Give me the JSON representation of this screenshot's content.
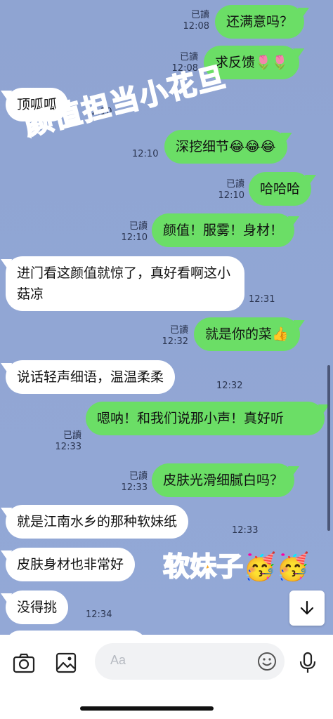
{
  "messages": {
    "m1": {
      "text": "还满意吗？",
      "read": "已讀",
      "time": "12:08"
    },
    "m2": {
      "text": "求反馈🌷🌷",
      "read": "已讀",
      "time": "12:08"
    },
    "m3": {
      "text": "顶呱呱",
      "time": "12:10"
    },
    "m4": {
      "text": "深挖细节😂😂😂",
      "time": "12:10"
    },
    "m5": {
      "text": "哈哈哈",
      "read": "已讀",
      "time": "12:10"
    },
    "m6": {
      "text": "颜值！服雾！身材！",
      "read": "已讀",
      "time": "12:10"
    },
    "m7": {
      "text": "进门看这颜值就惊了，真好看啊这小菇凉",
      "time": "12:31"
    },
    "m8": {
      "text": "就是你的菜👍",
      "read": "已讀",
      "time": "12:32"
    },
    "m9": {
      "text": "说话轻声细语，温温柔柔",
      "time": "12:32"
    },
    "m10": {
      "text": "嗯呐！和我们说那小声！真好听",
      "read": "已讀",
      "time": "12:33"
    },
    "m11": {
      "text": "皮肤光滑细腻白吗？",
      "read": "已讀",
      "time": "12:33"
    },
    "m12": {
      "text": "就是江南水乡的那种软妹纸",
      "time": "12:33"
    },
    "m13": {
      "text": "皮肤身材也非常好"
    },
    "m14": {
      "text": "没得挑",
      "time": "12:34"
    }
  },
  "overlays": {
    "red_caption": "颜值担当小花旦",
    "orange_caption": "软妹子🥳🥳"
  },
  "composer": {
    "placeholder": "Aa",
    "icons": [
      "camera-icon",
      "image-icon",
      "emoji-icon",
      "microphone-icon"
    ]
  },
  "scroll_button": {
    "icon": "arrow-down-icon"
  },
  "colors": {
    "background": "#8fa4d2",
    "my_bubble": "#6bde66",
    "their_bubble": "#ffffff",
    "red_caption": "#f05a7a",
    "orange_caption": "#f5a623"
  }
}
